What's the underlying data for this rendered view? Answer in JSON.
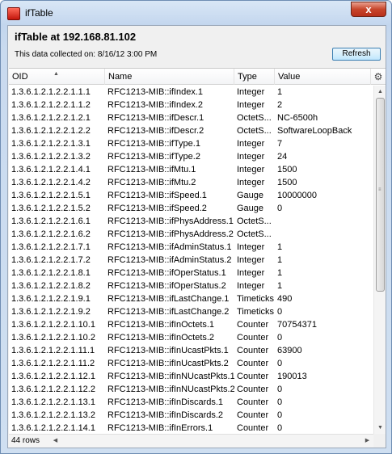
{
  "window": {
    "title": "ifTable",
    "close_glyph": "x"
  },
  "header": {
    "heading": "ifTable at 192.168.81.102",
    "collected": "This data collected on: 8/16/12 3:00 PM",
    "refresh_label": "Refresh"
  },
  "table": {
    "columns": [
      "OID",
      "Name",
      "Type",
      "Value"
    ],
    "rows": [
      [
        "1.3.6.1.2.1.2.2.1.1.1",
        "RFC1213-MIB::ifIndex.1",
        "Integer",
        "1"
      ],
      [
        "1.3.6.1.2.1.2.2.1.1.2",
        "RFC1213-MIB::ifIndex.2",
        "Integer",
        "2"
      ],
      [
        "1.3.6.1.2.1.2.2.1.2.1",
        "RFC1213-MIB::ifDescr.1",
        "OctetS...",
        "NC-6500h"
      ],
      [
        "1.3.6.1.2.1.2.2.1.2.2",
        "RFC1213-MIB::ifDescr.2",
        "OctetS...",
        "SoftwareLoopBack"
      ],
      [
        "1.3.6.1.2.1.2.2.1.3.1",
        "RFC1213-MIB::ifType.1",
        "Integer",
        "7"
      ],
      [
        "1.3.6.1.2.1.2.2.1.3.2",
        "RFC1213-MIB::ifType.2",
        "Integer",
        "24"
      ],
      [
        "1.3.6.1.2.1.2.2.1.4.1",
        "RFC1213-MIB::ifMtu.1",
        "Integer",
        "1500"
      ],
      [
        "1.3.6.1.2.1.2.2.1.4.2",
        "RFC1213-MIB::ifMtu.2",
        "Integer",
        "1500"
      ],
      [
        "1.3.6.1.2.1.2.2.1.5.1",
        "RFC1213-MIB::ifSpeed.1",
        "Gauge",
        "10000000"
      ],
      [
        "1.3.6.1.2.1.2.2.1.5.2",
        "RFC1213-MIB::ifSpeed.2",
        "Gauge",
        "0"
      ],
      [
        "1.3.6.1.2.1.2.2.1.6.1",
        "RFC1213-MIB::ifPhysAddress.1",
        "OctetS...",
        ""
      ],
      [
        "1.3.6.1.2.1.2.2.1.6.2",
        "RFC1213-MIB::ifPhysAddress.2",
        "OctetS...",
        ""
      ],
      [
        "1.3.6.1.2.1.2.2.1.7.1",
        "RFC1213-MIB::ifAdminStatus.1",
        "Integer",
        "1"
      ],
      [
        "1.3.6.1.2.1.2.2.1.7.2",
        "RFC1213-MIB::ifAdminStatus.2",
        "Integer",
        "1"
      ],
      [
        "1.3.6.1.2.1.2.2.1.8.1",
        "RFC1213-MIB::ifOperStatus.1",
        "Integer",
        "1"
      ],
      [
        "1.3.6.1.2.1.2.2.1.8.2",
        "RFC1213-MIB::ifOperStatus.2",
        "Integer",
        "1"
      ],
      [
        "1.3.6.1.2.1.2.2.1.9.1",
        "RFC1213-MIB::ifLastChange.1",
        "Timeticks",
        "490"
      ],
      [
        "1.3.6.1.2.1.2.2.1.9.2",
        "RFC1213-MIB::ifLastChange.2",
        "Timeticks",
        "0"
      ],
      [
        "1.3.6.1.2.1.2.2.1.10.1",
        "RFC1213-MIB::ifInOctets.1",
        "Counter",
        "70754371"
      ],
      [
        "1.3.6.1.2.1.2.2.1.10.2",
        "RFC1213-MIB::ifInOctets.2",
        "Counter",
        "0"
      ],
      [
        "1.3.6.1.2.1.2.2.1.11.1",
        "RFC1213-MIB::ifInUcastPkts.1",
        "Counter",
        "63900"
      ],
      [
        "1.3.6.1.2.1.2.2.1.11.2",
        "RFC1213-MIB::ifInUcastPkts.2",
        "Counter",
        "0"
      ],
      [
        "1.3.6.1.2.1.2.2.1.12.1",
        "RFC1213-MIB::ifInNUcastPkts.1",
        "Counter",
        "190013"
      ],
      [
        "1.3.6.1.2.1.2.2.1.12.2",
        "RFC1213-MIB::ifInNUcastPkts.2",
        "Counter",
        "0"
      ],
      [
        "1.3.6.1.2.1.2.2.1.13.1",
        "RFC1213-MIB::ifInDiscards.1",
        "Counter",
        "0"
      ],
      [
        "1.3.6.1.2.1.2.2.1.13.2",
        "RFC1213-MIB::ifInDiscards.2",
        "Counter",
        "0"
      ],
      [
        "1.3.6.1.2.1.2.2.1.14.1",
        "RFC1213-MIB::ifInErrors.1",
        "Counter",
        "0"
      ]
    ]
  },
  "footer": {
    "row_count": "44 rows"
  },
  "icons": {
    "app": "app-icon",
    "close": "close-icon",
    "settings": "gear-icon",
    "sort": "sort-ascending-icon"
  }
}
